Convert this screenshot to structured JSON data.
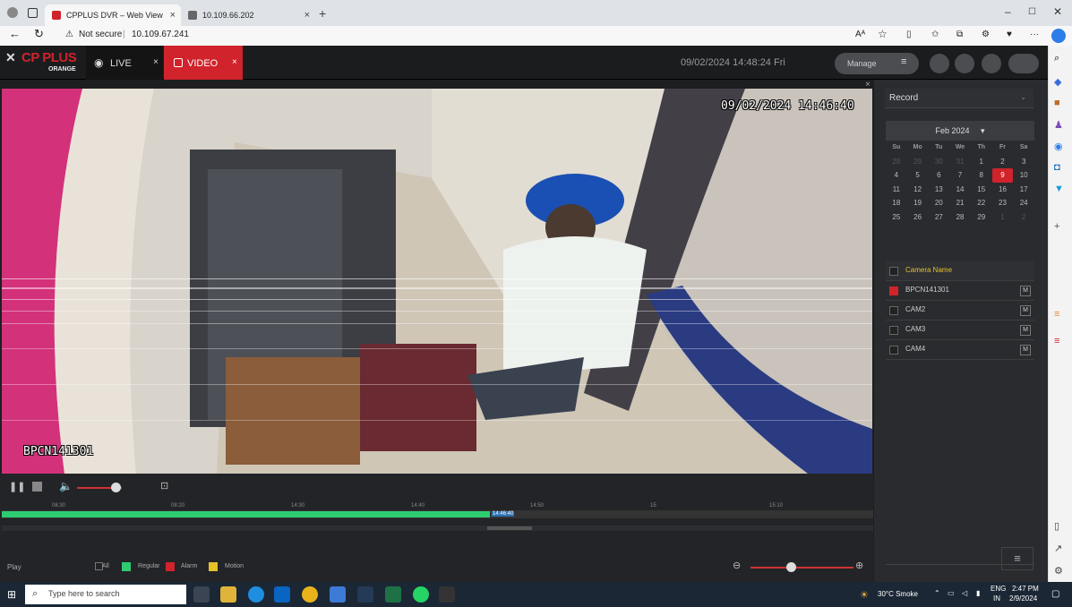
{
  "browser": {
    "tabs": [
      {
        "title": "CPPLUS DVR – Web View",
        "active": true
      },
      {
        "title": "10.109.66.202",
        "active": false
      }
    ],
    "security_label": "Not secure",
    "url": "10.109.67.241",
    "reader_label": "Aᴬ"
  },
  "app": {
    "brand": "CP PLUS",
    "brand_sub": "ORANGE",
    "tabs": {
      "live": "LIVE",
      "video": "VIDEO"
    },
    "datetime": "09/02/2024 14:48:24 Fri",
    "manage_label": "Manage",
    "colors": {
      "accent": "#d0232b",
      "timeline": "#2ecc71"
    }
  },
  "video": {
    "osd_timestamp": "09/02/2024 14:46:40",
    "osd_camera": "BPCN141301"
  },
  "timeline": {
    "ticks": [
      "08:30",
      "08:20",
      "14:30",
      "14:40",
      "14:50",
      "15",
      "15:10"
    ],
    "marker": "14:46:40",
    "play_label": "Play",
    "filters": [
      {
        "label": "All",
        "color": "#888888"
      },
      {
        "label": "Regular",
        "color": "#2ecc71"
      },
      {
        "label": "Alarm",
        "color": "#d0232b"
      },
      {
        "label": "Motion",
        "color": "#e6c229"
      }
    ]
  },
  "sidebar": {
    "record_select": "Record",
    "calendar": {
      "month": "Feb 2024",
      "weekdays": [
        "Su",
        "Mo",
        "Tu",
        "We",
        "Th",
        "Fr",
        "Sa"
      ],
      "weeks": [
        [
          "28",
          "29",
          "30",
          "31",
          "1",
          "2",
          "3"
        ],
        [
          "4",
          "5",
          "6",
          "7",
          "8",
          "9",
          "10"
        ],
        [
          "11",
          "12",
          "13",
          "14",
          "15",
          "16",
          "17"
        ],
        [
          "18",
          "19",
          "20",
          "21",
          "22",
          "23",
          "24"
        ],
        [
          "25",
          "26",
          "27",
          "28",
          "29",
          "1",
          "2"
        ]
      ],
      "selected": "9"
    },
    "camera_header": "Camera Name",
    "cameras": [
      {
        "name": "BPCN141301",
        "checked": true,
        "m": "M"
      },
      {
        "name": "CAM2",
        "checked": false,
        "m": "M"
      },
      {
        "name": "CAM3",
        "checked": false,
        "m": "M"
      },
      {
        "name": "CAM4",
        "checked": false,
        "m": "M"
      }
    ]
  },
  "taskbar": {
    "search_placeholder": "Type here to search",
    "weather": "30°C Smoke",
    "lang": "ENG",
    "region": "IN",
    "time": "2:47 PM",
    "date": "2/9/2024"
  }
}
